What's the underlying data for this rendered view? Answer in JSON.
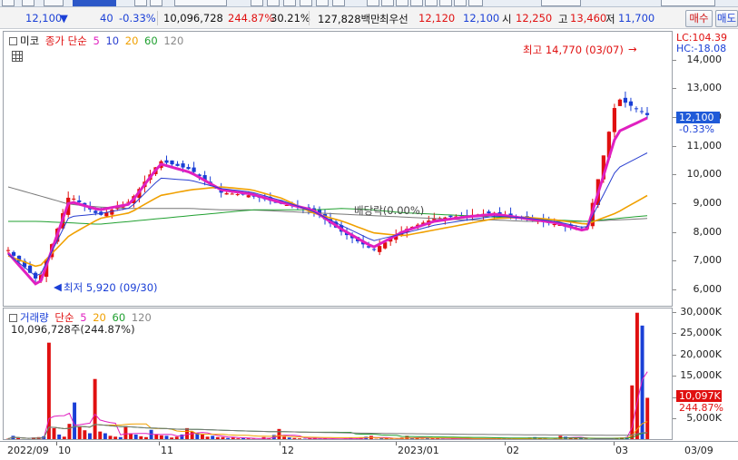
{
  "colors": {
    "up": "#e01010",
    "down": "#1a3fd6",
    "ma5": "#e020c0",
    "ma10": "#2a3fd0",
    "ma20": "#f0a000",
    "ma60": "#20a030",
    "ma120": "#777777"
  },
  "quote": {
    "price": "12,100",
    "change": "40",
    "change_pct": "-0.33%",
    "volume": "10,096,728",
    "volume_ratio": "244.87%",
    "turnover": "30.21%",
    "amount": "127,828백만",
    "best_bid_label": "최우선",
    "best_bid": "12,120",
    "best_ask": "12,100",
    "open_label": "시",
    "open": "12,250",
    "high_label": "고",
    "high": "13,460",
    "low_label": "저",
    "low": "11,700",
    "buy_button": "매수",
    "sell_button": "매도"
  },
  "price_pane": {
    "legend_box": "미코",
    "legend_title": "종가 단순",
    "periods": [
      "5",
      "10",
      "20",
      "60",
      "120"
    ],
    "lc": "LC:104.39",
    "hc": "HC:-18.08",
    "current_price": "12,100",
    "current_change": "-0.33%",
    "high_annotation": "최고 14,770 (03/07)",
    "low_annotation": "최저 5,920 (09/30)",
    "dividend_annotation": "배당락(0.00%)",
    "y_labels": [
      "14,000",
      "13,000",
      "12,000",
      "11,000",
      "10,000",
      "9,000",
      "8,000",
      "7,000",
      "6,000"
    ]
  },
  "volume_pane": {
    "legend_title": "거래량",
    "legend_ma": "단순",
    "periods": [
      "5",
      "20",
      "60",
      "120"
    ],
    "info": "10,096,728주(244.87%)",
    "current_volume": "10,097K",
    "current_pct": "244.87%",
    "y_labels": [
      "30,000K",
      "25,000K",
      "20,000K",
      "15,000K",
      "10,000K",
      "5,000K"
    ]
  },
  "x_axis": [
    "2022/09",
    "10",
    "11",
    "12",
    "2023/01",
    "02",
    "03",
    "03/09"
  ],
  "chart_data": [
    {
      "type": "line",
      "title": "",
      "xlabel": "",
      "ylabel": "",
      "ylim": [
        5400,
        15000
      ],
      "x": [
        "2022/09",
        "10",
        "11",
        "12",
        "2023/01",
        "02",
        "03"
      ],
      "series": [
        {
          "name": "종가",
          "values": [
            7400,
            6300,
            9300,
            8600,
            9100,
            10500,
            10200,
            9400,
            9300,
            9000,
            8800,
            8000,
            7400,
            8100,
            8500,
            8600,
            8700,
            8500,
            8300,
            8100,
            12700,
            12100
          ]
        },
        {
          "name": "5",
          "values": [
            7300,
            6100,
            9100,
            8800,
            9000,
            10400,
            10100,
            9500,
            9350,
            9050,
            8800,
            8100,
            7500,
            8050,
            8400,
            8550,
            8650,
            8500,
            8350,
            8050,
            11500,
            12000
          ]
        },
        {
          "name": "20",
          "values": [
            7200,
            6800,
            7900,
            8500,
            8700,
            9300,
            9500,
            9600,
            9500,
            9200,
            8700,
            8400,
            8000,
            7900,
            8100,
            8300,
            8500,
            8550,
            8450,
            8300,
            8700,
            9300
          ]
        },
        {
          "name": "60",
          "values": [
            8400,
            8400,
            8350,
            8300,
            8400,
            8500,
            8600,
            8700,
            8800,
            8800,
            8800,
            8850,
            8800,
            8700,
            8650,
            8600,
            8550,
            8500,
            8450,
            8400,
            8500,
            8600
          ]
        },
        {
          "name": "120",
          "values": [
            9600,
            9300,
            9000,
            8900,
            8850,
            8850,
            8850,
            8800,
            8800,
            8750,
            8700,
            8650,
            8600,
            8550,
            8500,
            8450,
            8450,
            8400,
            8400,
            8400,
            8450,
            8500
          ]
        }
      ]
    },
    {
      "type": "bar",
      "title": "",
      "xlabel": "",
      "ylabel": "",
      "ylim": [
        0,
        31000
      ],
      "values": [
        500,
        1200,
        700,
        400,
        300,
        800,
        900,
        1100,
        23000,
        3000,
        1500,
        1000,
        4000,
        9000,
        3500,
        2500,
        1800,
        14500,
        2200,
        1800,
        1200,
        1000,
        900,
        3500,
        1800,
        1500,
        1100,
        900,
        2600,
        1600,
        1300,
        1200,
        800,
        1000,
        1500,
        3000,
        2200,
        1800,
        1500,
        1000,
        1200,
        900,
        900,
        700,
        800,
        600,
        700,
        600,
        500,
        400,
        900,
        700,
        1400,
        2800,
        1000,
        800,
        700,
        600,
        500,
        600,
        700,
        500,
        600,
        400,
        400,
        500,
        600,
        700,
        500,
        700,
        1000,
        1200,
        500,
        600,
        700,
        500,
        400,
        800,
        1200,
        600,
        800,
        500,
        600,
        700,
        600,
        500,
        400,
        600,
        500,
        400,
        600,
        500,
        400,
        600,
        500,
        700,
        700,
        600,
        500,
        500,
        400,
        700,
        800,
        900,
        600,
        500,
        400,
        500,
        1200,
        1000,
        800,
        700,
        600,
        500,
        400,
        500,
        600,
        700,
        500,
        700,
        800,
        900,
        13000,
        30000,
        27000,
        10097
      ],
      "series_colors": "up-red / down-blue"
    }
  ]
}
